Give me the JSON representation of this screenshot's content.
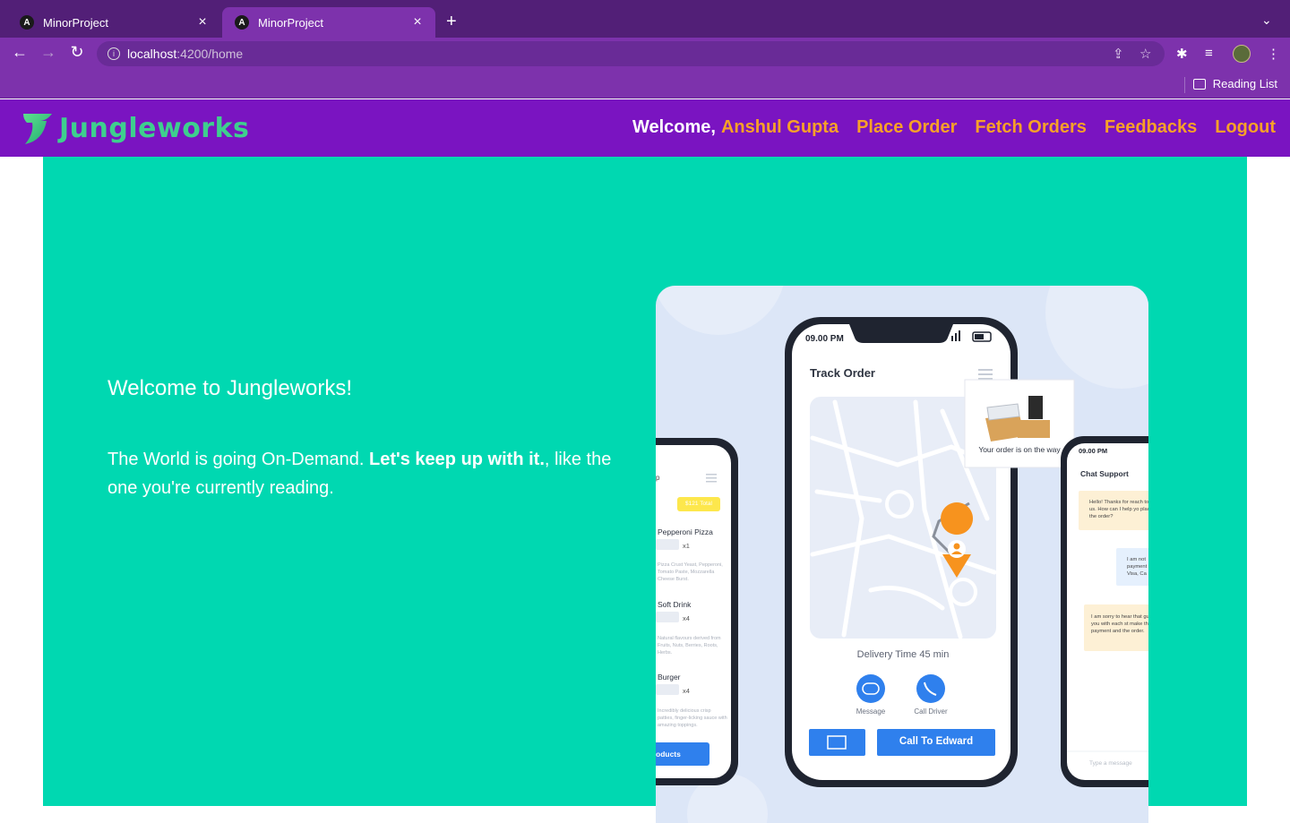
{
  "browser": {
    "tabs": [
      {
        "title": "MinorProject",
        "favicon": "A"
      },
      {
        "title": "MinorProject",
        "favicon": "A"
      }
    ],
    "url_host": "localhost",
    "url_path": ":4200/home",
    "reading_list": "Reading List"
  },
  "site": {
    "brand": "Jungleworks",
    "welcome": "Welcome,",
    "user": "Anshul Gupta",
    "nav": [
      "Place Order",
      "Fetch Orders",
      "Feedbacks",
      "Logout"
    ],
    "colors": {
      "header": "#7a14c1",
      "accent": "#f8a028",
      "hero": "#00d8b1",
      "logo": "#3ecf8e"
    }
  },
  "hero": {
    "heading": "Welcome to Jungleworks!",
    "lead_pre": "The World is going On-Demand. ",
    "lead_bold": "Let's keep up with it.",
    "lead_post": ", like the one you're currently reading."
  },
  "illustration": {
    "center_phone": {
      "time": "09.00 PM",
      "title": "Track Order",
      "popup": "Your order is on the way",
      "delivery": "Delivery Time 45 min",
      "message_label": "Message",
      "call_label": "Call Driver",
      "cta": "Call To Edward"
    },
    "left_phone": {
      "badge": "$121 Total",
      "items": [
        {
          "name": "Pepperoni Pizza",
          "qty": "x1",
          "desc": "Pizza Crust Yeast, Pepperoni, Tomato Paste, Mozzarella Cheese Burst."
        },
        {
          "name": "Soft Drink",
          "qty": "x4",
          "desc": "Natural flavours derived from Fruits, Nuts, Berries, Roots, Herbs."
        },
        {
          "name": "Burger",
          "qty": "x4",
          "desc": "Incredibly delicious crisp patties, finger-licking sauce with amazing toppings."
        }
      ],
      "cta": "oducts"
    },
    "right_phone": {
      "time": "09.00 PM",
      "title": "Chat Support",
      "msgs": [
        "Hello! Thanks for reach to us. How can I help yo place the order?",
        "I am not payment Visa, Ca",
        "I am sorry to hear that guide you with each st make the payment and the order."
      ],
      "input": "Type a message"
    }
  }
}
